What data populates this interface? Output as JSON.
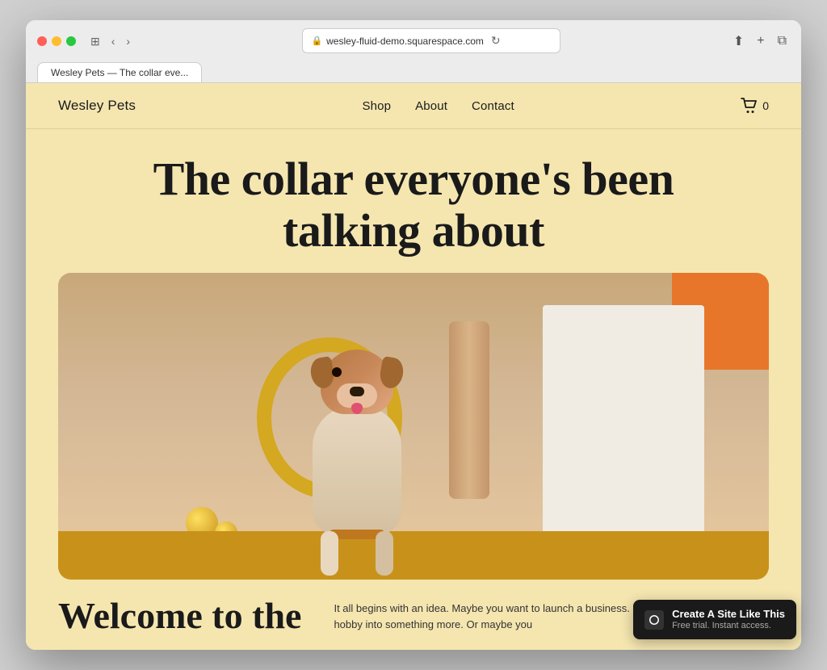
{
  "browser": {
    "url": "wesley-fluid-demo.squarespace.com",
    "tab_label": "Wesley Pets — The collar eve...",
    "reload_icon": "↻",
    "back_icon": "‹",
    "forward_icon": "›",
    "share_icon": "⬆",
    "new_tab_icon": "+",
    "windows_icon": "⧉",
    "grid_icon": "⊞"
  },
  "site": {
    "logo": "Wesley Pets",
    "nav": {
      "links": [
        {
          "label": "Shop",
          "href": "#"
        },
        {
          "label": "About",
          "href": "#"
        },
        {
          "label": "Contact",
          "href": "#"
        }
      ]
    },
    "cart_count": "0",
    "hero_title_line1": "The collar everyone's been",
    "hero_title_line2": "talking about",
    "welcome_text": "Welcome to the",
    "intro_text": "It all begins with an idea. Maybe you want to launch a business. Maybe you want to turn a hobby into something more. Or maybe you"
  },
  "badge": {
    "logo_icon": "◼",
    "main_text": "Create A Site Like This",
    "sub_text": "Free trial. Instant access."
  }
}
